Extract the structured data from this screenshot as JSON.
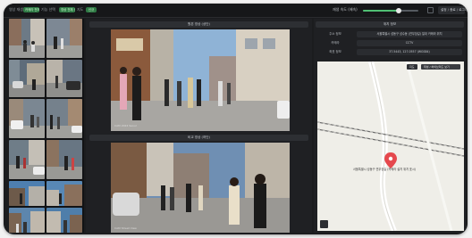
{
  "topbar": {
    "labels": [
      "영상 재생",
      "기능 선택",
      "지도",
      "목록"
    ],
    "pills": [
      "카메라 전체",
      "영상 전체 선택",
      "신규"
    ],
    "right_label": "재생 속도 (배속)",
    "button": "설정 / 종료 / 로그아웃"
  },
  "center": {
    "top_label": "원본 영상 (상단)",
    "bottom_label": "비교 영상 (하단)",
    "watermark_top": "CAM  2024  Seoul",
    "watermark_bottom": "CAM  Street  View"
  },
  "right": {
    "header": "위치 정보",
    "rows": [
      {
        "key": "주소 정보",
        "value": "서울특별시 성동구 성수동 (연무장길) 일대 카메라 위치"
      },
      {
        "key": "카메라",
        "value": "CCTV"
      },
      {
        "key": "좌표 정보",
        "value": "37.5443, 127.0557 (WGS84)"
      }
    ],
    "map_buttons": [
      "지도",
      "위성 / 하이브리드 보기"
    ],
    "map_caption": "서울특별시 성동구 연무장길 (카메라 설치 위치 표시)"
  },
  "colors": {
    "accent": "#4fbf73",
    "pin": "#e5484d",
    "bg": "#1b1c1e"
  }
}
